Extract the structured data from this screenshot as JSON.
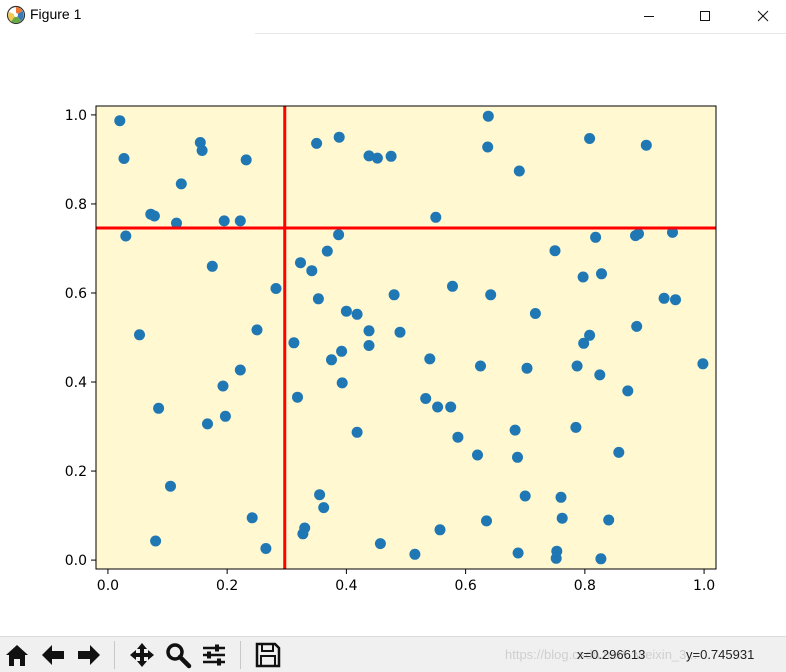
{
  "window": {
    "title": "Figure 1",
    "icons": {
      "app": "matplotlib-icon",
      "minimize": "minimize-icon",
      "maximize": "maximize-icon",
      "close": "close-icon"
    }
  },
  "toolbar": {
    "tools": [
      "home-icon",
      "back-arrow-icon",
      "forward-arrow-icon",
      "pan-icon",
      "zoom-icon",
      "configure-subplots-icon",
      "save-icon"
    ],
    "x_readout": "x=0.296613",
    "y_readout": "y=0.745931",
    "watermark": "https://blog.csdn.net/...weixin_3..."
  },
  "chart_data": {
    "type": "scatter",
    "title": "",
    "xlabel": "",
    "ylabel": "",
    "xlim": [
      -0.02,
      1.02
    ],
    "ylim": [
      -0.02,
      1.02
    ],
    "xticks": [
      "0.0",
      "0.2",
      "0.4",
      "0.6",
      "0.8",
      "1.0"
    ],
    "yticks": [
      "0.0",
      "0.2",
      "0.4",
      "0.6",
      "0.8",
      "1.0"
    ],
    "grid": false,
    "legend": "none",
    "colors": {
      "axes_bg": "#fff8d1",
      "points": "#1f77b4",
      "crosshair": "#ff0000"
    },
    "crosshair": {
      "x": 0.296613,
      "y": 0.745931
    },
    "points": [
      [
        0.02,
        0.987
      ],
      [
        0.027,
        0.902
      ],
      [
        0.03,
        0.728
      ],
      [
        0.053,
        0.506
      ],
      [
        0.072,
        0.777
      ],
      [
        0.078,
        0.773
      ],
      [
        0.08,
        0.043
      ],
      [
        0.085,
        0.341
      ],
      [
        0.105,
        0.166
      ],
      [
        0.115,
        0.757
      ],
      [
        0.123,
        0.845
      ],
      [
        0.155,
        0.938
      ],
      [
        0.158,
        0.92
      ],
      [
        0.167,
        0.306
      ],
      [
        0.175,
        0.66
      ],
      [
        0.193,
        0.391
      ],
      [
        0.195,
        0.762
      ],
      [
        0.197,
        0.323
      ],
      [
        0.222,
        0.427
      ],
      [
        0.222,
        0.762
      ],
      [
        0.232,
        0.899
      ],
      [
        0.242,
        0.095
      ],
      [
        0.25,
        0.517
      ],
      [
        0.265,
        0.026
      ],
      [
        0.282,
        0.61
      ],
      [
        0.312,
        0.488
      ],
      [
        0.318,
        0.366
      ],
      [
        0.323,
        0.668
      ],
      [
        0.327,
        0.059
      ],
      [
        0.33,
        0.072
      ],
      [
        0.342,
        0.65
      ],
      [
        0.35,
        0.936
      ],
      [
        0.353,
        0.587
      ],
      [
        0.355,
        0.147
      ],
      [
        0.362,
        0.118
      ],
      [
        0.368,
        0.694
      ],
      [
        0.375,
        0.45
      ],
      [
        0.387,
        0.731
      ],
      [
        0.388,
        0.95
      ],
      [
        0.392,
        0.469
      ],
      [
        0.393,
        0.398
      ],
      [
        0.4,
        0.559
      ],
      [
        0.418,
        0.552
      ],
      [
        0.418,
        0.287
      ],
      [
        0.438,
        0.908
      ],
      [
        0.438,
        0.515
      ],
      [
        0.438,
        0.482
      ],
      [
        0.452,
        0.903
      ],
      [
        0.457,
        0.037
      ],
      [
        0.475,
        0.907
      ],
      [
        0.48,
        0.596
      ],
      [
        0.49,
        0.512
      ],
      [
        0.515,
        0.013
      ],
      [
        0.533,
        0.363
      ],
      [
        0.54,
        0.452
      ],
      [
        0.55,
        0.77
      ],
      [
        0.553,
        0.344
      ],
      [
        0.557,
        0.068
      ],
      [
        0.575,
        0.344
      ],
      [
        0.578,
        0.615
      ],
      [
        0.587,
        0.276
      ],
      [
        0.62,
        0.236
      ],
      [
        0.625,
        0.436
      ],
      [
        0.635,
        0.088
      ],
      [
        0.637,
        0.928
      ],
      [
        0.638,
        0.997
      ],
      [
        0.642,
        0.596
      ],
      [
        0.683,
        0.292
      ],
      [
        0.687,
        0.231
      ],
      [
        0.688,
        0.016
      ],
      [
        0.69,
        0.874
      ],
      [
        0.7,
        0.144
      ],
      [
        0.703,
        0.431
      ],
      [
        0.717,
        0.554
      ],
      [
        0.75,
        0.695
      ],
      [
        0.752,
        0.004
      ],
      [
        0.753,
        0.02
      ],
      [
        0.76,
        0.141
      ],
      [
        0.762,
        0.094
      ],
      [
        0.785,
        0.298
      ],
      [
        0.787,
        0.436
      ],
      [
        0.797,
        0.636
      ],
      [
        0.798,
        0.487
      ],
      [
        0.808,
        0.505
      ],
      [
        0.808,
        0.947
      ],
      [
        0.818,
        0.725
      ],
      [
        0.825,
        0.416
      ],
      [
        0.827,
        0.003
      ],
      [
        0.828,
        0.643
      ],
      [
        0.84,
        0.09
      ],
      [
        0.857,
        0.242
      ],
      [
        0.872,
        0.38
      ],
      [
        0.885,
        0.729
      ],
      [
        0.887,
        0.525
      ],
      [
        0.89,
        0.733
      ],
      [
        0.903,
        0.932
      ],
      [
        0.933,
        0.588
      ],
      [
        0.947,
        0.736
      ],
      [
        0.952,
        0.585
      ],
      [
        0.998,
        0.441
      ]
    ]
  }
}
